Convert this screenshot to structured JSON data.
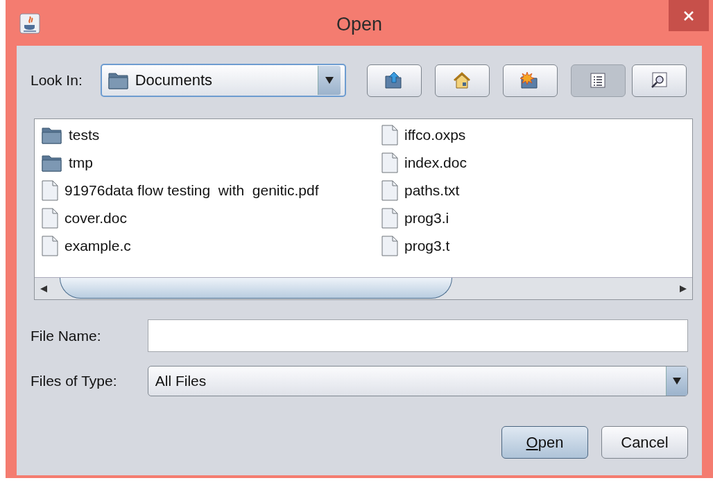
{
  "window": {
    "title": "Open"
  },
  "look_in": {
    "label": "Look In:",
    "value": "Documents"
  },
  "toolbar": [
    {
      "kind": "up",
      "selected": false
    },
    {
      "kind": "home",
      "selected": false
    },
    {
      "kind": "new-folder",
      "selected": false
    },
    {
      "kind": "list",
      "selected": true
    },
    {
      "kind": "details",
      "selected": false
    }
  ],
  "files": [
    {
      "name": "tests",
      "kind": "folder"
    },
    {
      "name": "tmp",
      "kind": "folder"
    },
    {
      "name": "91976data flow testing  with  genitic.pdf",
      "kind": "file"
    },
    {
      "name": "cover.doc",
      "kind": "file"
    },
    {
      "name": "example.c",
      "kind": "file"
    },
    {
      "name": "iffco.oxps",
      "kind": "file"
    },
    {
      "name": "index.doc",
      "kind": "file"
    },
    {
      "name": "paths.txt",
      "kind": "file"
    },
    {
      "name": "prog3.i",
      "kind": "file"
    },
    {
      "name": "prog3.t",
      "kind": "file"
    }
  ],
  "file_name": {
    "label": "File Name:"
  },
  "files_of_type": {
    "label": "Files of Type:",
    "value": "All Files"
  },
  "buttons": [
    {
      "mnemonic": "O",
      "text": "pen",
      "default": true
    },
    {
      "text": "Cancel",
      "default": false
    }
  ]
}
